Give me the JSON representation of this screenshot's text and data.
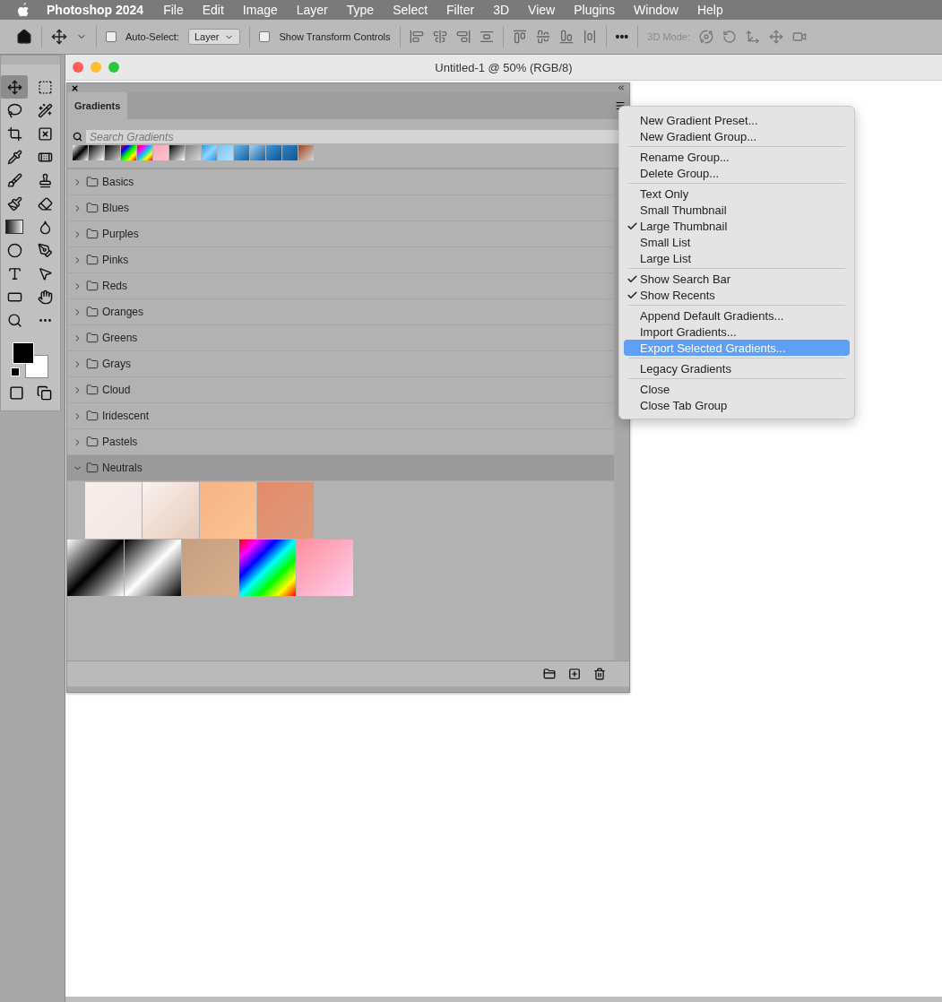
{
  "menu_bar": {
    "app": "Photoshop 2024",
    "items": [
      "File",
      "Edit",
      "Image",
      "Layer",
      "Type",
      "Select",
      "Filter",
      "3D",
      "View",
      "Plugins",
      "Window",
      "Help"
    ]
  },
  "options_bar": {
    "auto_select": {
      "label": "Auto-Select:",
      "checked": false
    },
    "target": "Layer",
    "transform_controls": {
      "label": "Show Transform Controls",
      "checked": false
    },
    "more": "•••",
    "mode_label": "3D Mode:"
  },
  "tools": [
    {
      "selected": true
    },
    {
      "selected": false
    },
    {
      "selected": false
    },
    {
      "selected": false
    },
    {
      "selected": false
    },
    {
      "selected": false
    },
    {
      "selected": false
    },
    {
      "selected": false
    },
    {
      "selected": false
    },
    {
      "selected": false
    },
    {
      "selected": false
    },
    {
      "selected": false
    },
    {
      "selected": false
    },
    {
      "selected": false
    },
    {
      "selected": false
    },
    {
      "selected": false
    },
    {
      "selected": false
    },
    {
      "selected": false
    },
    {
      "selected": false
    },
    {
      "selected": false
    },
    {
      "selected": false
    },
    {
      "selected": false
    }
  ],
  "document": {
    "title": "Untitled-1 @ 50% (RGB/8)"
  },
  "gradients_panel": {
    "tab": {
      "label": "Gradients",
      "selected": true
    },
    "search": {
      "placeholder": "Search Gradients"
    },
    "groups": [
      {
        "name": "Basics",
        "expanded": false
      },
      {
        "name": "Blues",
        "expanded": false
      },
      {
        "name": "Purples",
        "expanded": false
      },
      {
        "name": "Pinks",
        "expanded": false
      },
      {
        "name": "Reds",
        "expanded": false
      },
      {
        "name": "Oranges",
        "expanded": false
      },
      {
        "name": "Greens",
        "expanded": false
      },
      {
        "name": "Grays",
        "expanded": false
      },
      {
        "name": "Cloud",
        "expanded": false
      },
      {
        "name": "Iridescent",
        "expanded": false
      },
      {
        "name": "Pastels",
        "expanded": false
      },
      {
        "name": "Neutrals",
        "expanded": true
      }
    ]
  },
  "panel_menu": {
    "sections": [
      [
        {
          "label": "New Gradient Preset...",
          "checked": false,
          "selected": false
        },
        {
          "label": "New Gradient Group...",
          "checked": false,
          "selected": false
        }
      ],
      [
        {
          "label": "Rename Group...",
          "checked": false,
          "selected": false
        },
        {
          "label": "Delete Group...",
          "checked": false,
          "selected": false
        }
      ],
      [
        {
          "label": "Text Only",
          "checked": false,
          "selected": false
        },
        {
          "label": "Small Thumbnail",
          "checked": false,
          "selected": false
        },
        {
          "label": "Large Thumbnail",
          "checked": true,
          "selected": false
        },
        {
          "label": "Small List",
          "checked": false,
          "selected": false
        },
        {
          "label": "Large List",
          "checked": false,
          "selected": false
        }
      ],
      [
        {
          "label": "Show Search Bar",
          "checked": true,
          "selected": false
        },
        {
          "label": "Show Recents",
          "checked": true,
          "selected": false
        }
      ],
      [
        {
          "label": "Append Default Gradients...",
          "checked": false,
          "selected": false
        },
        {
          "label": "Import Gradients...",
          "checked": false,
          "selected": false
        },
        {
          "label": "Export Selected Gradients...",
          "checked": false,
          "selected": true
        }
      ],
      [
        {
          "label": "Legacy Gradients",
          "checked": false,
          "selected": false
        }
      ],
      [
        {
          "label": "Close",
          "checked": false,
          "selected": false
        },
        {
          "label": "Close Tab Group",
          "checked": false,
          "selected": false
        }
      ]
    ]
  }
}
